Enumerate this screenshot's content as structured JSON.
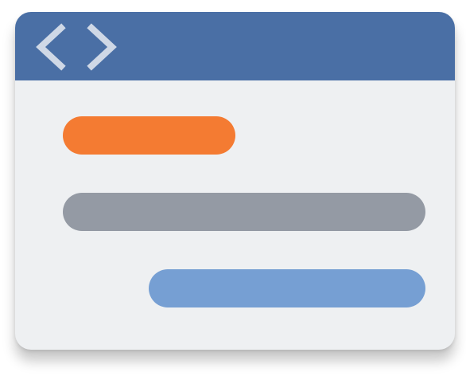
{
  "window": {
    "icon": "code-brackets-icon",
    "colors": {
      "titlebar": "#4a6fa5",
      "body": "#eef0f2",
      "icon": "#cfd8e6"
    }
  },
  "content_bars": [
    {
      "name": "orange-bar",
      "color": "#f47b32"
    },
    {
      "name": "gray-bar",
      "color": "#949aa4"
    },
    {
      "name": "blue-bar",
      "color": "#769fd3"
    }
  ]
}
